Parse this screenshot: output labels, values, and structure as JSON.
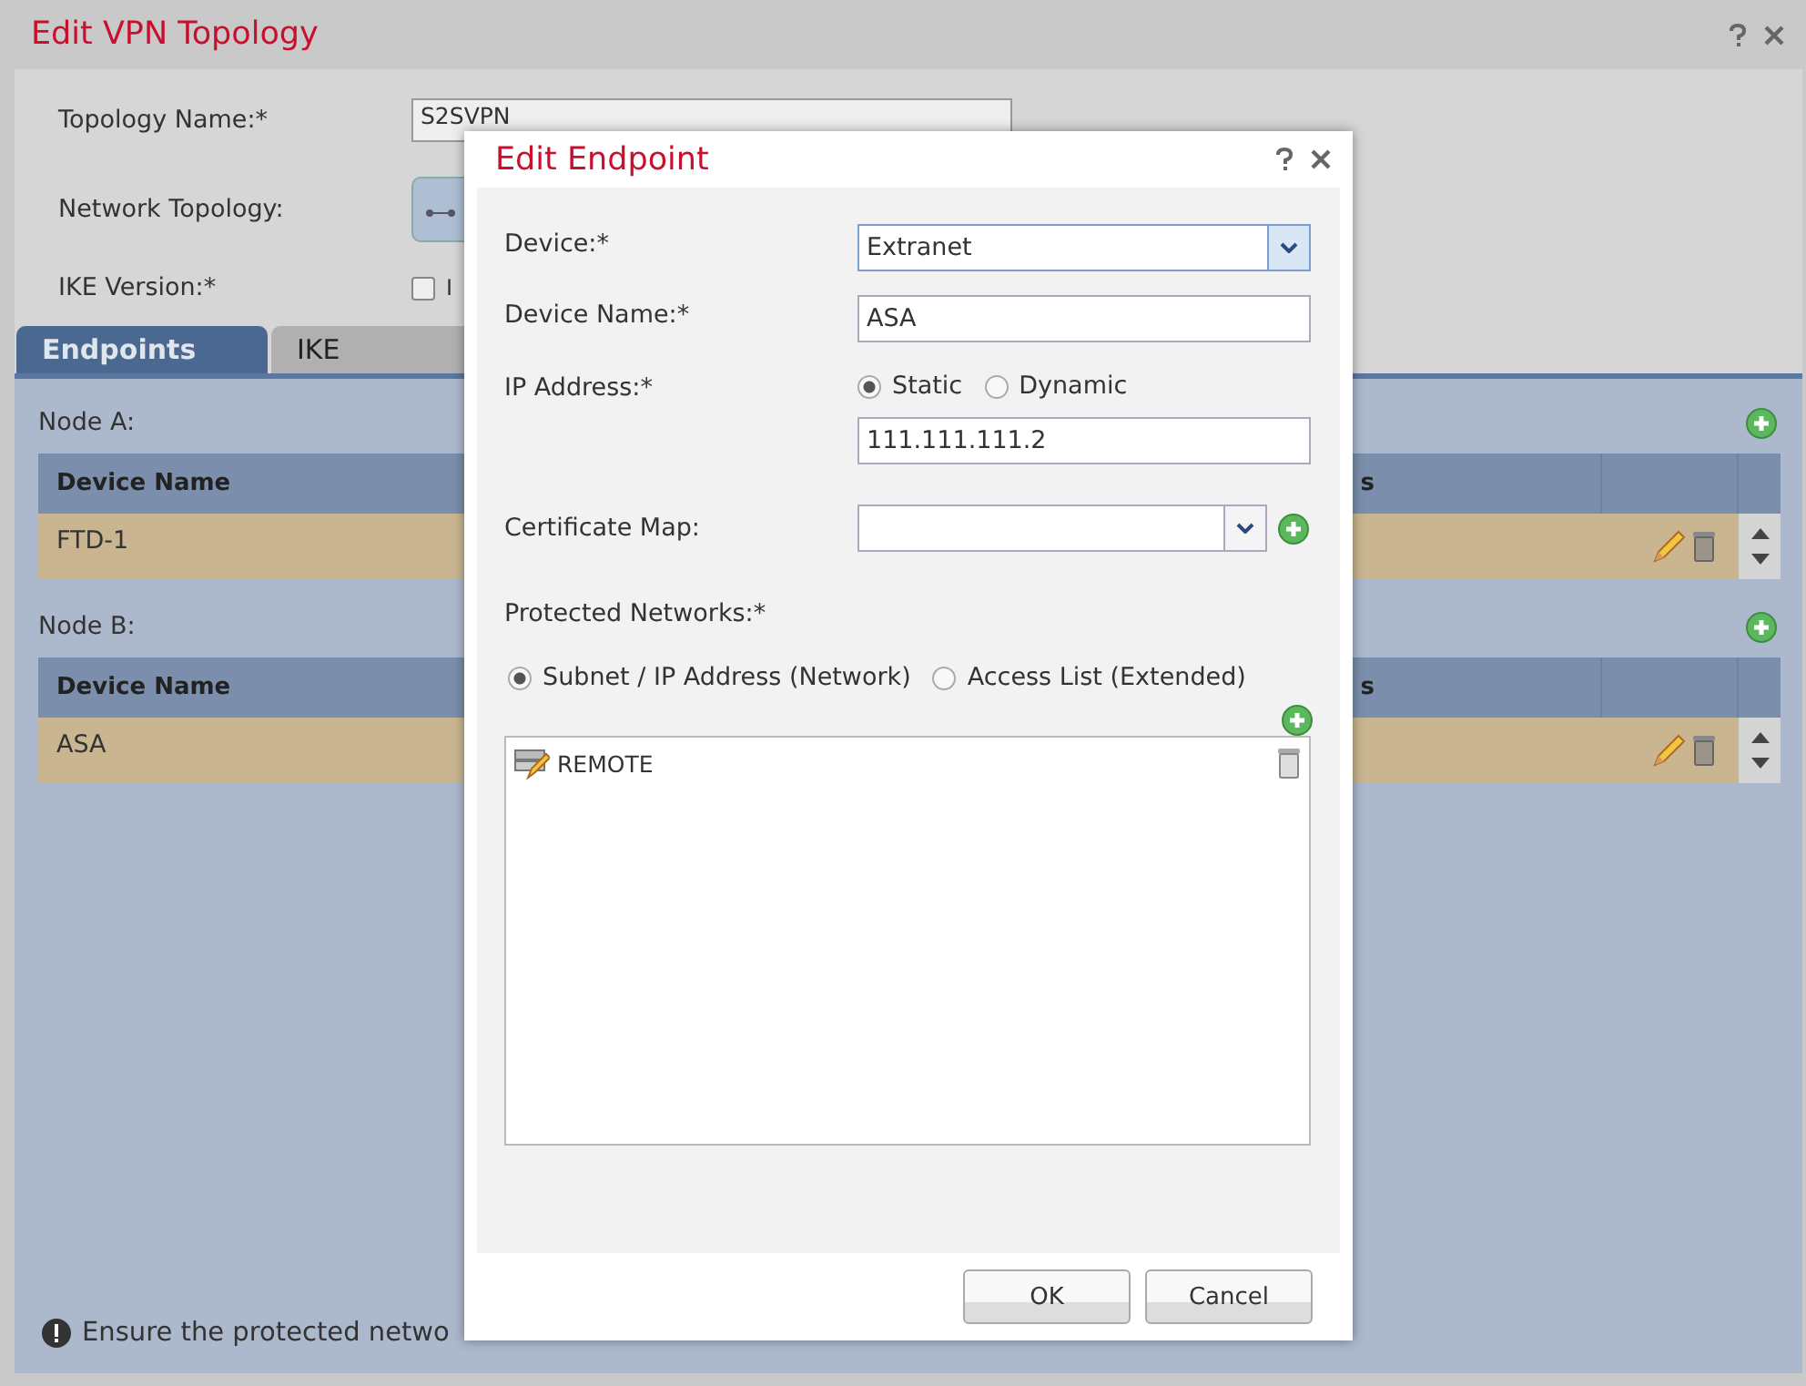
{
  "window": {
    "title": "Edit VPN Topology"
  },
  "form": [
    {
      "label": "Topology Name:*",
      "kind": "text",
      "value": "S2SVPN"
    },
    {
      "label": "Network Topology:",
      "kind": "topology"
    },
    {
      "label": "IKE Version:*",
      "kind": "checkbox",
      "checked": false,
      "option": "I"
    }
  ],
  "tabs": [
    {
      "label": "Endpoints",
      "selected": true
    },
    {
      "label": "IKE",
      "selected": false
    }
  ],
  "nodes": [
    {
      "label": "Node A:",
      "columns": [
        "Device Name",
        "s"
      ],
      "rows": [
        {
          "device_name": "FTD-1"
        }
      ]
    },
    {
      "label": "Node B:",
      "columns": [
        "Device Name",
        "s"
      ],
      "rows": [
        {
          "device_name": "ASA"
        }
      ]
    }
  ],
  "notice": "Ensure the protected netwo",
  "dialog": {
    "title": "Edit Endpoint",
    "device": {
      "label": "Device:*",
      "value": "Extranet"
    },
    "device_name": {
      "label": "Device Name:*",
      "value": "ASA"
    },
    "ip_address": {
      "label": "IP Address:*",
      "options": [
        {
          "label": "Static",
          "selected": true
        },
        {
          "label": "Dynamic",
          "selected": false
        }
      ],
      "value": "111.111.111.2"
    },
    "certificate_map": {
      "label": "Certificate Map:"
    },
    "protected_networks": {
      "label": "Protected Networks:*",
      "options": [
        {
          "label": "Subnet / IP Address (Network)",
          "selected": true
        },
        {
          "label": "Access List (Extended)",
          "selected": false
        }
      ],
      "items": [
        "REMOTE"
      ]
    },
    "buttons": [
      "OK",
      "Cancel"
    ]
  }
}
